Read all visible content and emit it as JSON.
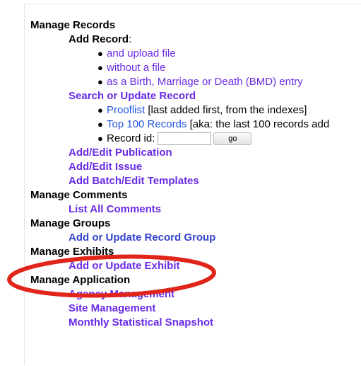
{
  "menu": {
    "records": {
      "heading": "Manage Records",
      "add_label": "Add Record",
      "add_colon": ":",
      "add_items": [
        "and upload file",
        "without a file",
        "as a Birth, Marriage or Death (BMD) entry"
      ],
      "search_label": "Search or Update Record",
      "prooflist_link": "Prooflist",
      "prooflist_note": " [last added first, from the indexes]",
      "top100_link": "Top 100 Records",
      "top100_note": " [aka: the last 100 records add",
      "record_id_label": "Record id:",
      "record_id_value": "",
      "go_label": "go",
      "publication": "Add/Edit Publication",
      "issue": "Add/Edit Issue",
      "batch": "Add Batch/Edit Templates"
    },
    "comments": {
      "heading": "Manage Comments",
      "list": "List All Comments"
    },
    "groups": {
      "heading": "Manage Groups",
      "add": "Add or Update Record Group"
    },
    "exhibits": {
      "heading": "Manage Exhibits",
      "add": "Add or Update Exhibit"
    },
    "application": {
      "heading": "Manage Application",
      "agency": "Agency Management",
      "site": "Site Management",
      "snapshot": "Monthly Statistical Snapshot"
    }
  },
  "annotation": {
    "color": "#e0251b"
  }
}
